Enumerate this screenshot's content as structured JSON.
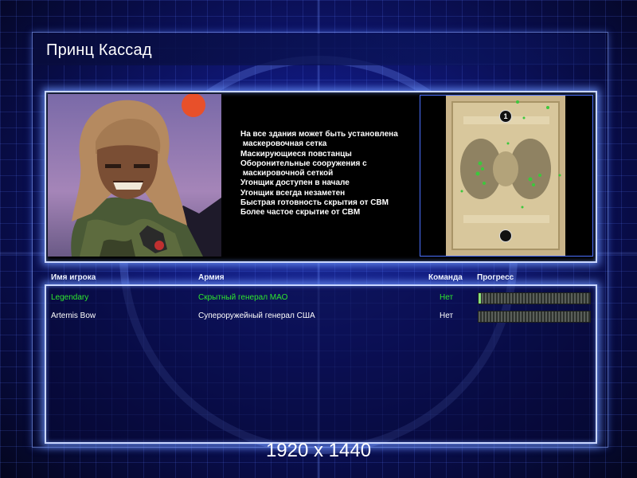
{
  "window": {
    "title": "Принц Кассад"
  },
  "general": {
    "portrait_icon": "general-portrait-image",
    "features": [
      "На все здания может быть установлена",
      " маскеровочная сетка",
      "Маскирующиеся повстанцы",
      "Оборонительные сооружения с",
      " маскировочной сеткой",
      "Угонщик доступен в начале",
      "Угонщик всегда незаметен",
      "Быстрая готовность скрытия от СВМ",
      "Более частое скрытие от СВМ"
    ]
  },
  "map": {
    "start_markers": [
      "1",
      ""
    ]
  },
  "table": {
    "headers": {
      "player": "Имя игрока",
      "army": "Армия",
      "team": "Команда",
      "progress": "Прогресс"
    },
    "rows": [
      {
        "player": "Legendary",
        "army": "Скрытный генерал МАО",
        "team": "Нет",
        "progress": 0.02,
        "color": "#2ee82e"
      },
      {
        "player": "Artemis Bow",
        "army": "Супероружейный генерал США",
        "team": "Нет",
        "progress": 0.0,
        "color": "#ffffff"
      }
    ]
  },
  "footer": {
    "resolution": "1920 x 1440"
  },
  "colors": {
    "accent": "#c9d6ff",
    "local_player": "#2ee82e"
  }
}
